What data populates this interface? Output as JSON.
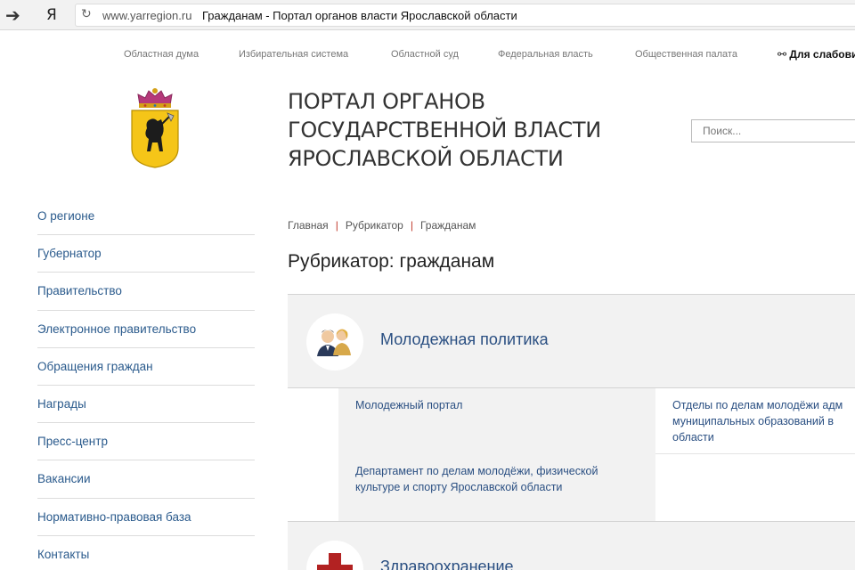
{
  "browser": {
    "back_glyph": "➔",
    "ya_logo": "Я",
    "reload_glyph": "↻",
    "url": "www.yarregion.ru",
    "page_title": "Гражданам - Портал органов власти Ярославской области"
  },
  "top_links": [
    "Областная дума",
    "Избирательная система",
    "Областной суд",
    "Федеральная власть",
    "Общественная палата"
  ],
  "accessibility_label": "Для слабови...",
  "header": {
    "title_line1": "ПОРТАЛ ОРГАНОВ",
    "title_line2": "ГОСУДАРСТВЕННОЙ ВЛАСТИ",
    "title_line3": "ЯРОСЛАВСКОЙ ОБЛАСТИ",
    "search_placeholder": "Поиск..."
  },
  "sidebar": {
    "items": [
      "О регионе",
      "Губернатор",
      "Правительство",
      "Электронное правительство",
      "Обращения граждан",
      "Награды",
      "Пресс-центр",
      "Вакансии",
      "Нормативно-правовая база",
      "Контакты"
    ]
  },
  "breadcrumb": {
    "home": "Главная",
    "sep": "|",
    "rubricator": "Рубрикатор",
    "current": "Гражданам"
  },
  "page_heading": "Рубрикатор: гражданам",
  "categories": [
    {
      "title": "Молодежная политика",
      "icon": "people-icon",
      "links": [
        "Молодежный портал",
        "Отделы по делам молодёжи адм... муниципальных образований в... области",
        "Департамент по делам молодёжи, физической культуре и спорту Ярославской области"
      ],
      "link_lines": {
        "link2_line1": "Отделы по делам молодёжи адм",
        "link2_line2": "муниципальных образований в",
        "link2_line3": "области",
        "link3_line1": "Департамент по делам молодёжи, физической",
        "link3_line2": "культуре и спорту Ярославской области"
      }
    },
    {
      "title": "Здравоохранение",
      "icon": "medical-cross-icon"
    }
  ],
  "colors": {
    "link": "#2a4f82",
    "sidebar_link": "#2a5a8c",
    "separator": "#c0392b",
    "block_bg": "#f2f2f2",
    "coat_yellow": "#f5c518",
    "cross_red": "#b22222"
  }
}
